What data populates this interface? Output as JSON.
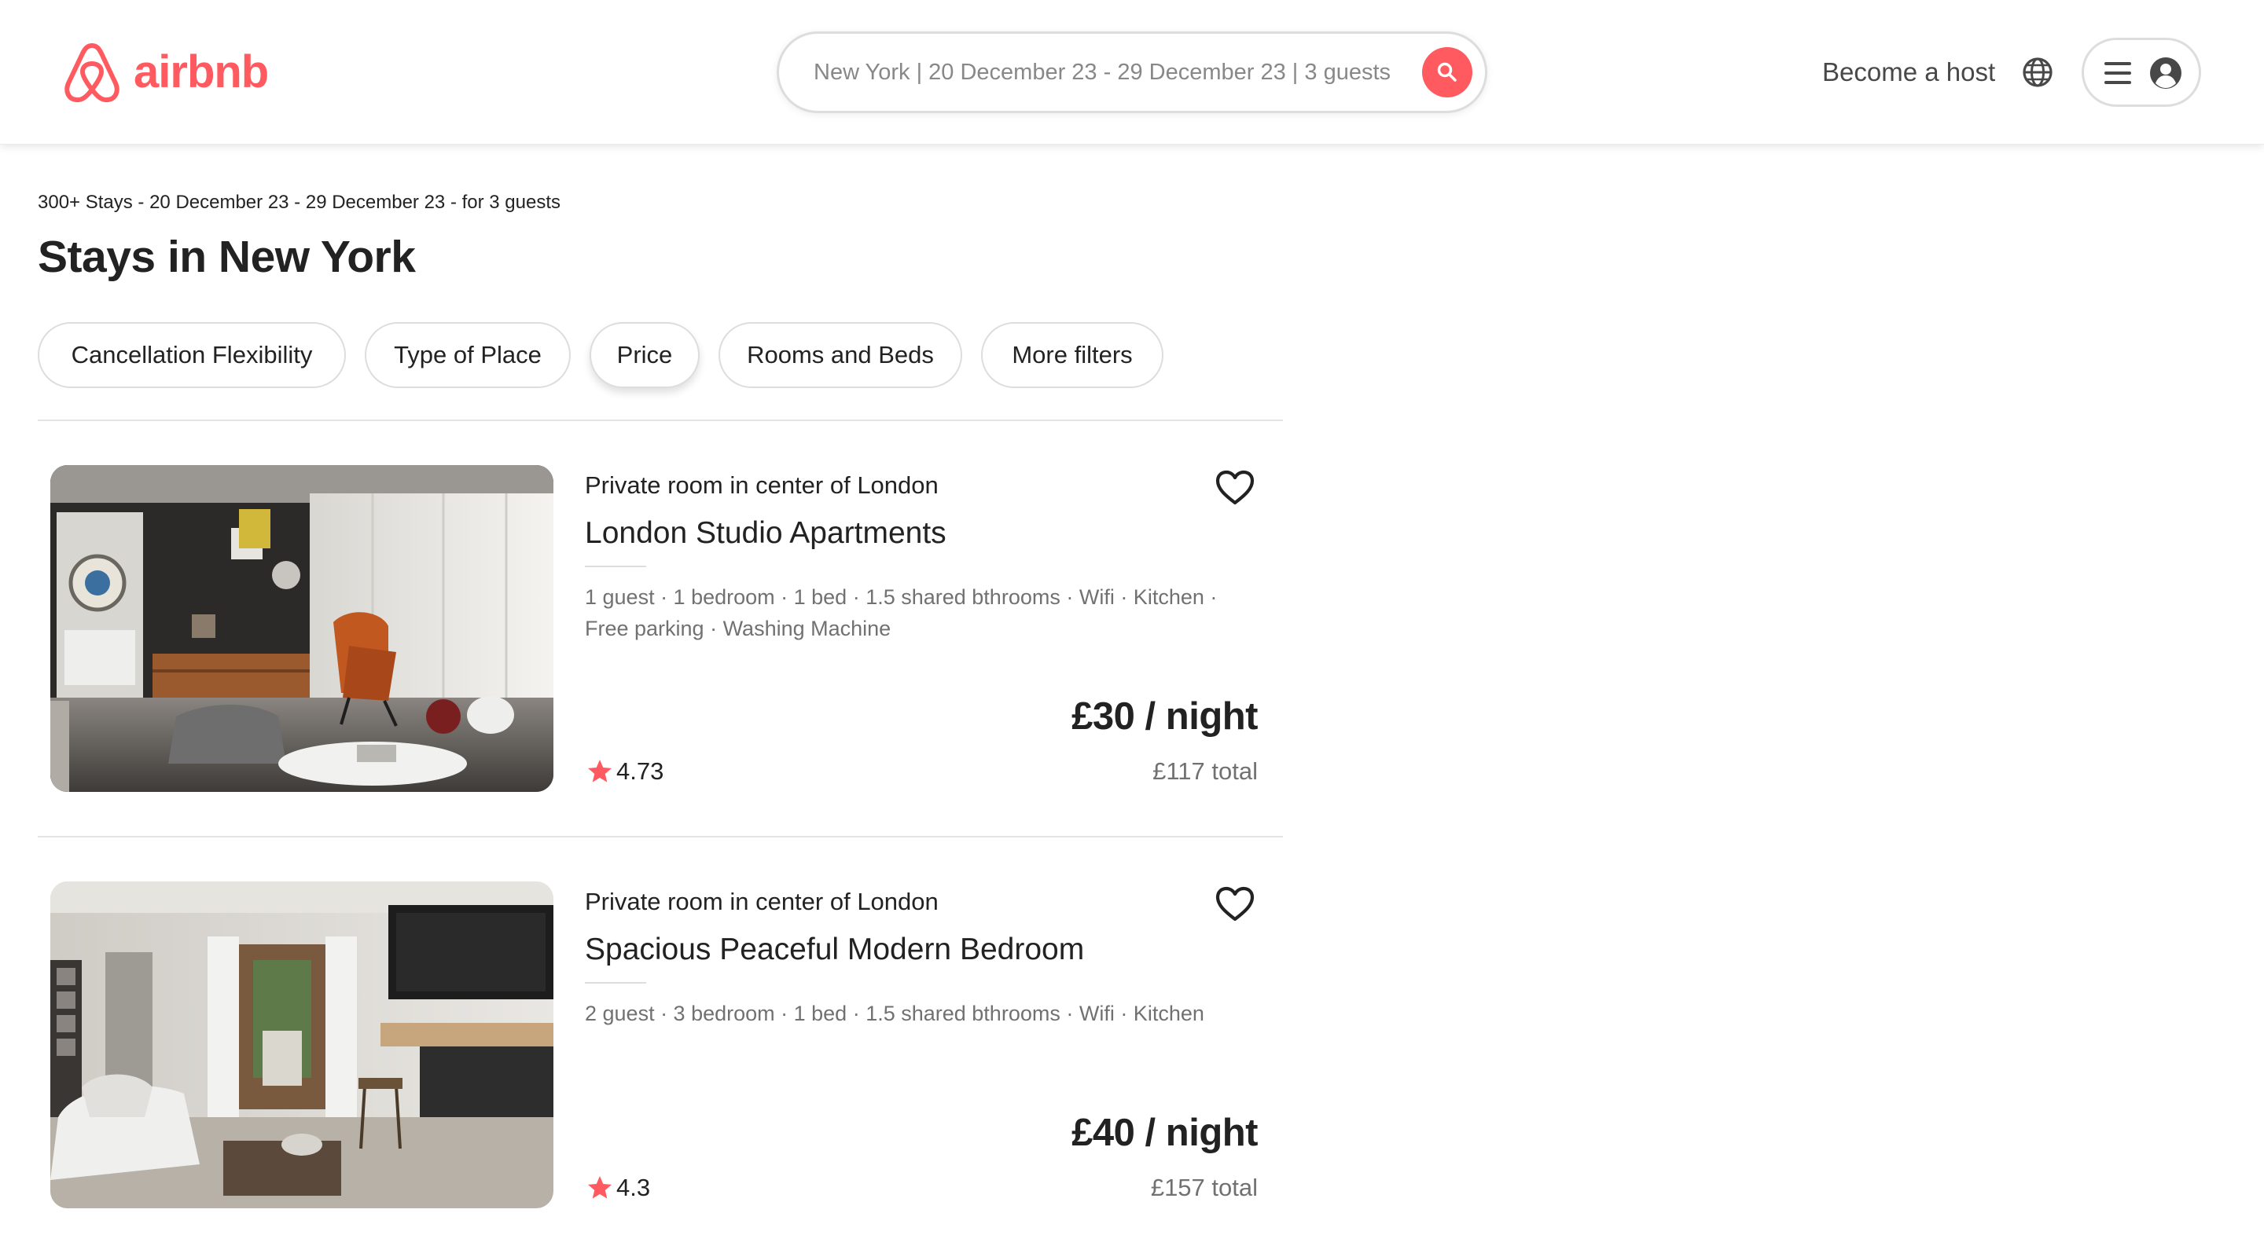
{
  "brand": {
    "name": "airbnb",
    "color": "#ff5a5f"
  },
  "header": {
    "search": {
      "value": "New York | 20 December 23 - 29 December 23 | 3 guests",
      "button_icon": "search-icon"
    },
    "become_host": "Become a host",
    "language_icon": "globe-icon",
    "menu_icons": [
      "menu-icon",
      "user-icon"
    ]
  },
  "results": {
    "summary": "300+ Stays - 20 December 23 - 29 December 23 - for 3 guests",
    "title": "Stays in New York"
  },
  "filters": [
    {
      "label": "Cancellation Flexibility"
    },
    {
      "label": "Type of Place"
    },
    {
      "label": "Price"
    },
    {
      "label": "Rooms and Beds"
    },
    {
      "label": "More filters"
    }
  ],
  "listings": [
    {
      "type": "Private room in center of London",
      "name": "London Studio Apartments",
      "amenities": "1 guest · 1 bedroom · 1 bed · 1.5 shared bthrooms · Wifi · Kitchen · Free parking · Washing Machine",
      "price": "£30 / night",
      "total": "£117 total",
      "rating": "4.73",
      "image": "studio-apartment-photo"
    },
    {
      "type": "Private room in center of London",
      "name": "Spacious Peaceful Modern Bedroom",
      "amenities": "2 guest · 3 bedroom · 1 bed · 1.5 shared bthrooms · Wifi · Kitchen",
      "price": "£40 / night",
      "total": "£157 total",
      "rating": "4.3",
      "image": "modern-living-room-photo"
    }
  ]
}
